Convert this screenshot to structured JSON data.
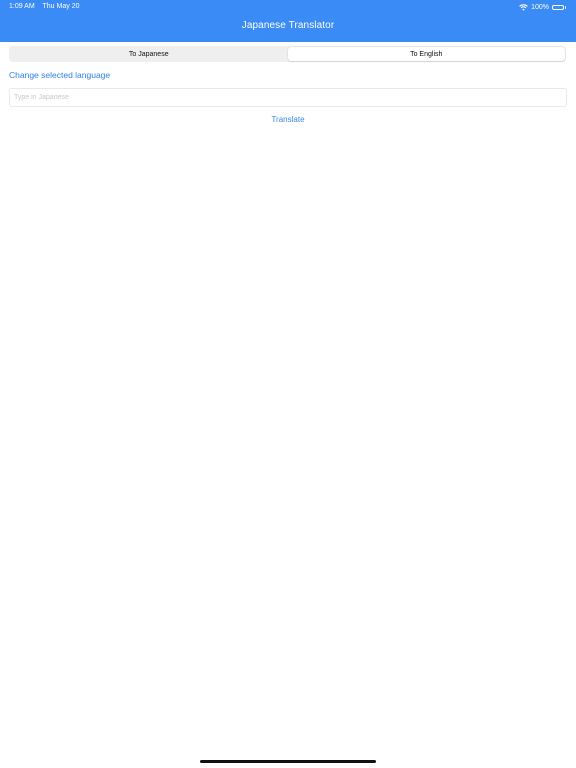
{
  "status_bar": {
    "time": "1:09 AM",
    "date": "Thu May 20",
    "battery": "100%",
    "wifi_icon": "wifi-icon",
    "battery_icon": "battery-icon"
  },
  "header": {
    "title": "Japanese Translator",
    "background_color": "#3a8bf5"
  },
  "segments": [
    {
      "label": "To Japanese",
      "selected": false
    },
    {
      "label": "To English",
      "selected": true
    }
  ],
  "change_language_label": "Change selected language",
  "input": {
    "placeholder": "Type in Japanese",
    "value": ""
  },
  "translate_label": "Translate"
}
